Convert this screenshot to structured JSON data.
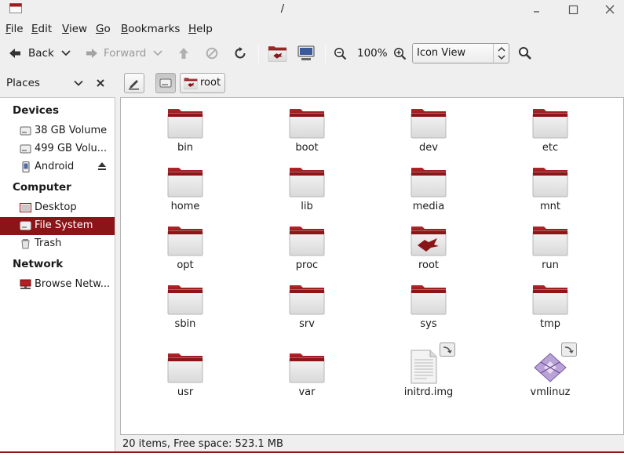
{
  "window": {
    "title": "/"
  },
  "menu": [
    {
      "mnemonic": "F",
      "rest": "ile"
    },
    {
      "mnemonic": "E",
      "rest": "dit"
    },
    {
      "mnemonic": "V",
      "rest": "iew"
    },
    {
      "mnemonic": "G",
      "rest": "o"
    },
    {
      "mnemonic": "B",
      "rest": "ookmarks"
    },
    {
      "mnemonic": "H",
      "rest": "elp"
    }
  ],
  "toolbar": {
    "back_label": "Back",
    "forward_label": "Forward",
    "zoom_level": "100%",
    "view_mode": "Icon View"
  },
  "pathbar": {
    "places_label": "Places",
    "crumb_root": "root"
  },
  "sidebar": {
    "devices_header": "Devices",
    "devices": [
      "38 GB Volume",
      "499 GB Volu...",
      "Android"
    ],
    "computer_header": "Computer",
    "computer": [
      "Desktop",
      "File System",
      "Trash"
    ],
    "network_header": "Network",
    "network": [
      "Browse Netw..."
    ]
  },
  "files": [
    {
      "name": "bin",
      "icon": "folder-icon"
    },
    {
      "name": "boot",
      "icon": "folder-icon"
    },
    {
      "name": "dev",
      "icon": "folder-icon"
    },
    {
      "name": "etc",
      "icon": "folder-icon"
    },
    {
      "name": "home",
      "icon": "folder-icon"
    },
    {
      "name": "lib",
      "icon": "folder-icon"
    },
    {
      "name": "media",
      "icon": "folder-icon"
    },
    {
      "name": "mnt",
      "icon": "folder-icon"
    },
    {
      "name": "opt",
      "icon": "folder-icon"
    },
    {
      "name": "proc",
      "icon": "folder-icon"
    },
    {
      "name": "root",
      "icon": "home-folder-icon"
    },
    {
      "name": "run",
      "icon": "folder-icon"
    },
    {
      "name": "sbin",
      "icon": "folder-icon"
    },
    {
      "name": "srv",
      "icon": "folder-icon"
    },
    {
      "name": "sys",
      "icon": "folder-icon"
    },
    {
      "name": "tmp",
      "icon": "folder-icon"
    },
    {
      "name": "usr",
      "icon": "folder-icon"
    },
    {
      "name": "var",
      "icon": "folder-icon"
    },
    {
      "name": "initrd.img",
      "icon": "text-file-link-icon"
    },
    {
      "name": "vmlinuz",
      "icon": "binary-file-link-icon"
    }
  ],
  "status": {
    "text": "20 items, Free space: 523.1 MB"
  },
  "colors": {
    "accent": "#8a1417",
    "folder_top": "#9b1b1e"
  }
}
